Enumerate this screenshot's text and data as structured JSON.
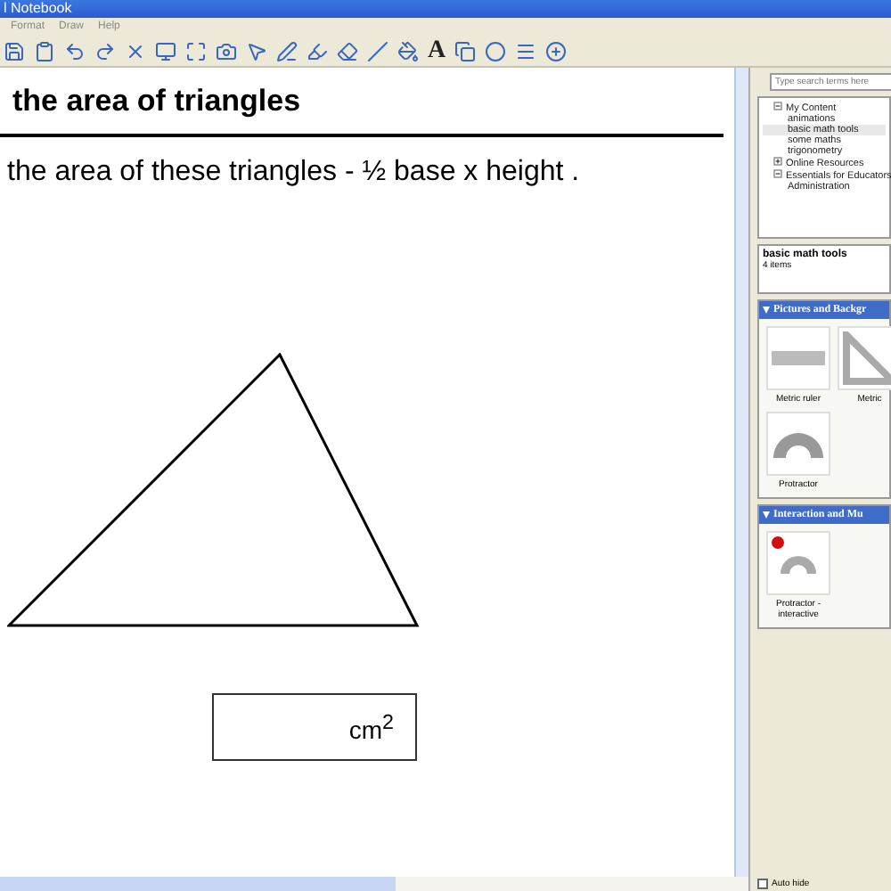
{
  "window": {
    "title": "l Notebook"
  },
  "menu": [
    "Format",
    "Draw",
    "Help"
  ],
  "toolbar": {
    "text_tool": "A"
  },
  "page": {
    "title": "the area of triangles",
    "instruction": "the area of these triangles - ½ base x height .",
    "answer": {
      "unit": "cm$^{2}$"
    }
  },
  "sidebar": {
    "search": {
      "placeholder": "Type search terms here"
    },
    "tree": [
      {
        "label": "My Content",
        "expanded": true,
        "selected": false,
        "children": [
          {
            "label": "animations",
            "selected": false
          },
          {
            "label": "basic math tools",
            "selected": true
          },
          {
            "label": "some maths",
            "selected": false
          },
          {
            "label": "trigonometry",
            "selected": false
          }
        ]
      },
      {
        "label": "Online Resources",
        "expanded": false,
        "selected": false
      },
      {
        "label": "Essentials for Educators",
        "expanded": true,
        "selected": false,
        "children": [
          {
            "label": "Administration",
            "selected": false
          }
        ]
      }
    ],
    "folder": {
      "title": "basic math tools",
      "count": "4 items"
    },
    "sections": [
      {
        "title": "Pictures and Backgr",
        "items": [
          {
            "label": "Metric ruler",
            "kind": "ruler"
          },
          {
            "label": "Metric",
            "kind": "square"
          },
          {
            "label": "Protractor",
            "kind": "protractor"
          }
        ]
      },
      {
        "title": "Interaction and Mu",
        "items": [
          {
            "label": "Protractor - interactive",
            "kind": "protractor-interactive"
          }
        ]
      }
    ],
    "auto_hide": {
      "label": "Auto hide",
      "checked": false
    }
  }
}
